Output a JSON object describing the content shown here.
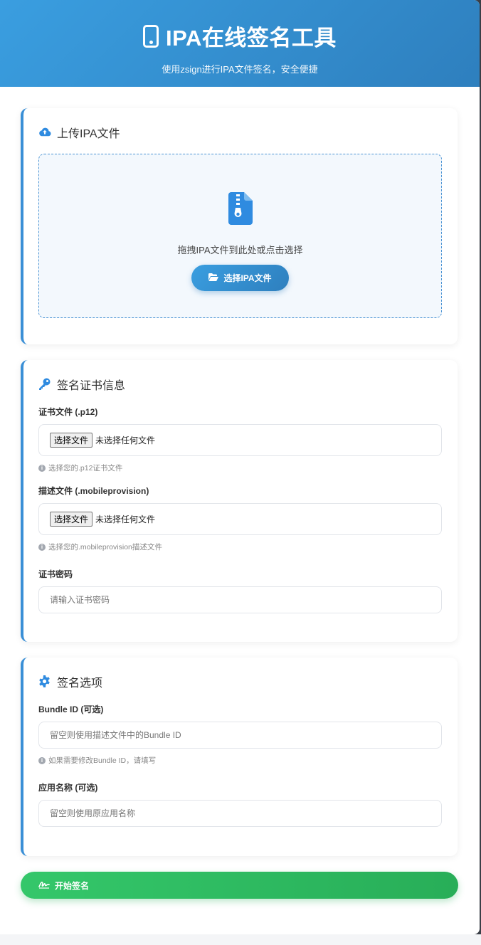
{
  "header": {
    "title": "IPA在线签名工具",
    "subtitle": "使用zsign进行IPA文件签名，安全便捷"
  },
  "upload": {
    "title": "上传IPA文件",
    "hint": "拖拽IPA文件到此处或点击选择",
    "button": "选择IPA文件"
  },
  "cert": {
    "title": "签名证书信息",
    "p12_label": "证书文件 (.p12)",
    "p12_button": "选择文件",
    "p12_status": "未选择任何文件",
    "p12_help": "选择您的.p12证书文件",
    "prov_label": "描述文件 (.mobileprovision)",
    "prov_button": "选择文件",
    "prov_status": "未选择任何文件",
    "prov_help": "选择您的.mobileprovision描述文件",
    "password_label": "证书密码",
    "password_placeholder": "请输入证书密码"
  },
  "options": {
    "title": "签名选项",
    "bundle_label": "Bundle ID (可选)",
    "bundle_placeholder": "留空则使用描述文件中的Bundle ID",
    "bundle_help": "如果需要修改Bundle ID，请填写",
    "appname_label": "应用名称 (可选)",
    "appname_placeholder": "留空则使用原应用名称"
  },
  "start_button": "开始签名",
  "colors": {
    "primary": "#3a8fd6",
    "success": "#2fbd62"
  }
}
